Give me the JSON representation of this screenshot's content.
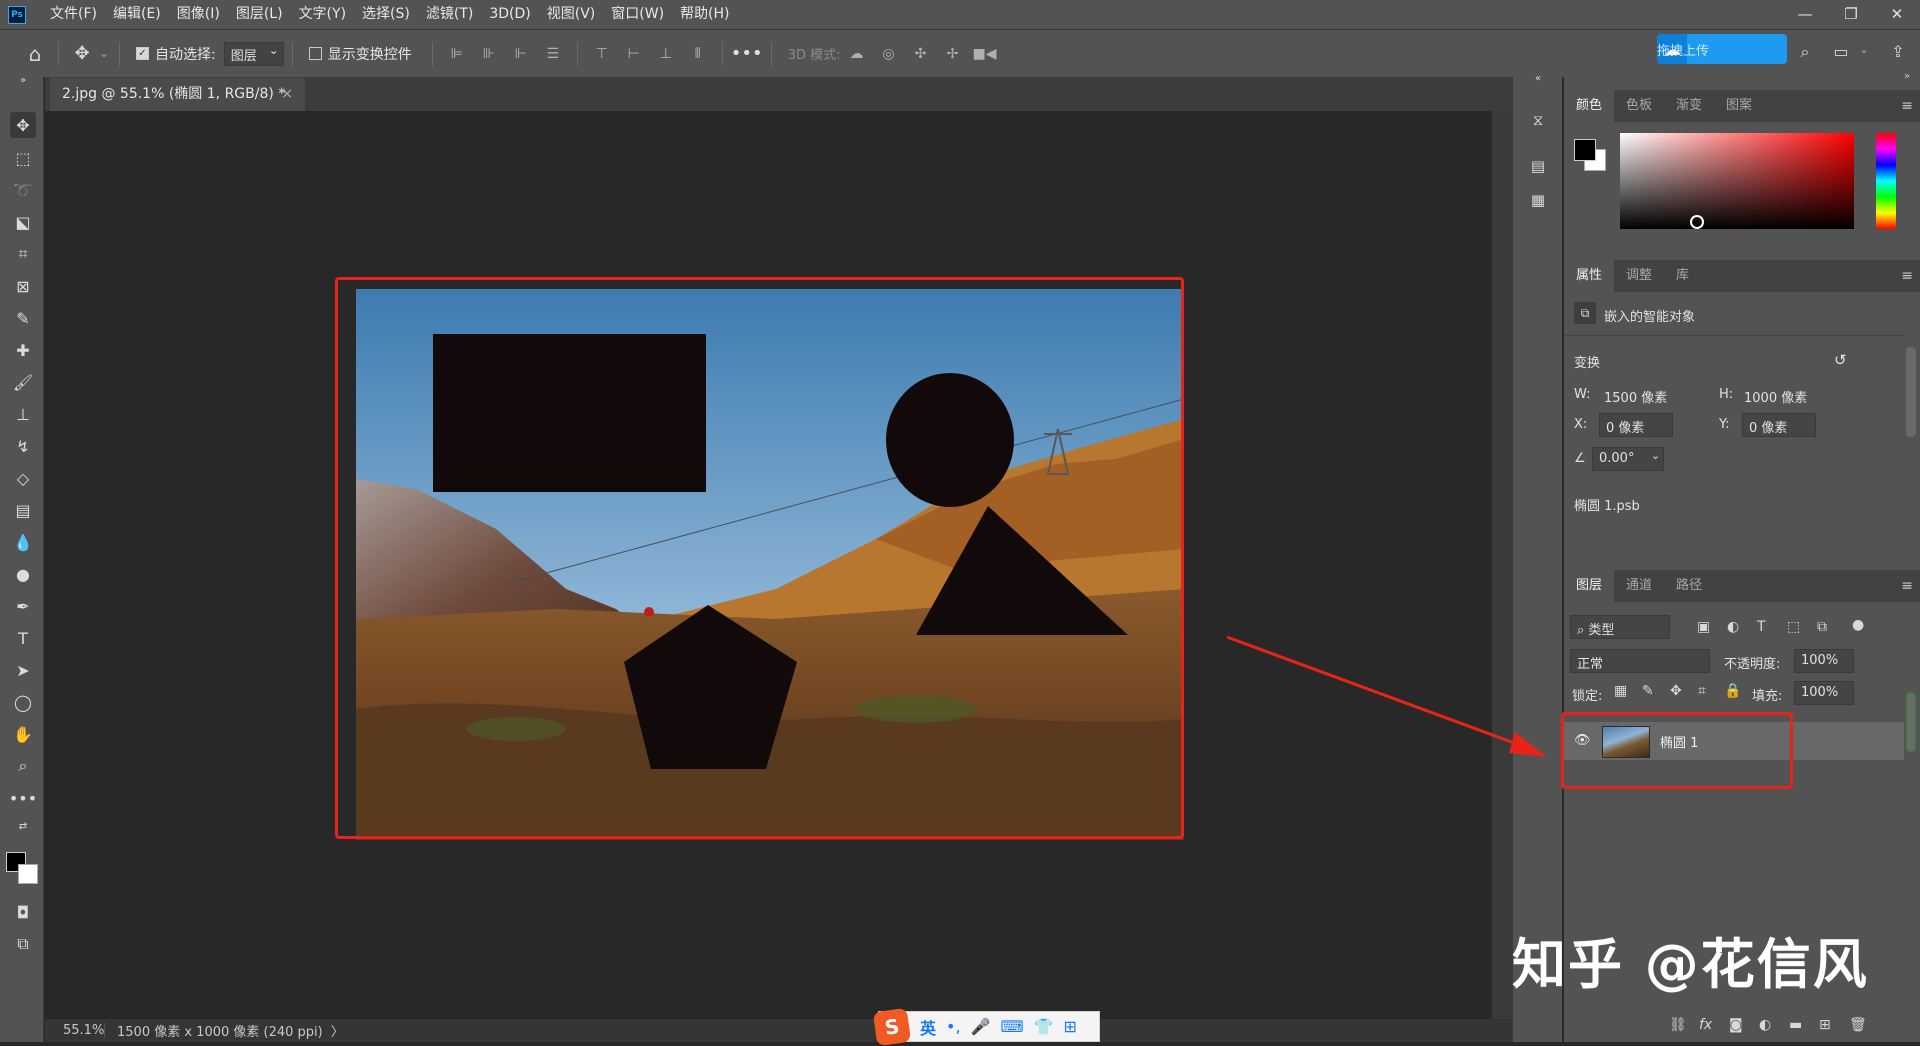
{
  "menubar": {
    "items": [
      "文件(F)",
      "编辑(E)",
      "图像(I)",
      "图层(L)",
      "文字(Y)",
      "选择(S)",
      "滤镜(T)",
      "3D(D)",
      "视图(V)",
      "窗口(W)",
      "帮助(H)"
    ],
    "logo": "Ps",
    "window_controls": [
      "—",
      "❐",
      "✕"
    ]
  },
  "options": {
    "auto_select_label": "自动选择:",
    "auto_select_value": "图层",
    "show_transform_label": "显示变换控件",
    "mode_3d_label": "3D 模式:",
    "upload_label": "拖拽上传"
  },
  "document": {
    "tab_title": "2.jpg @ 55.1% (椭圆 1, RGB/8) *",
    "tab_close": "×"
  },
  "status": {
    "zoom": "55.1%",
    "info": "1500 像素 x 1000 像素 (240 ppi)",
    "arrow": "〉"
  },
  "ime": {
    "logo": "S",
    "lang": "英",
    "punct": "•,",
    "mic": "🎤",
    "keyboard": "⌨",
    "shirt": "👕",
    "apps": "⊞"
  },
  "color_panel": {
    "tabs": [
      "颜色",
      "色板",
      "渐变",
      "图案"
    ]
  },
  "properties_panel": {
    "tabs": [
      "属性",
      "调整",
      "库"
    ],
    "object_type": "嵌入的智能对象",
    "transform_label": "变换",
    "w_label": "W:",
    "w_value": "1500 像素",
    "h_label": "H:",
    "h_value": "1000 像素",
    "x_label": "X:",
    "x_value": "0 像素",
    "y_label": "Y:",
    "y_value": "0 像素",
    "angle_value": "0.00°",
    "file_name": "椭圆 1.psb"
  },
  "layers_panel": {
    "tabs": [
      "图层",
      "通道",
      "路径"
    ],
    "filter_label": "类型",
    "blend_mode": "正常",
    "opacity_label": "不透明度:",
    "opacity_value": "100%",
    "lock_label": "锁定:",
    "fill_label": "填充:",
    "fill_value": "100%",
    "layer_name": "椭圆 1"
  },
  "watermark": "知乎 @花信风",
  "colors": {
    "annotation_red": "#e8231a",
    "ui_bg": "#535353",
    "canvas_bg": "#282828",
    "accent_blue": "#1d9bf0"
  }
}
